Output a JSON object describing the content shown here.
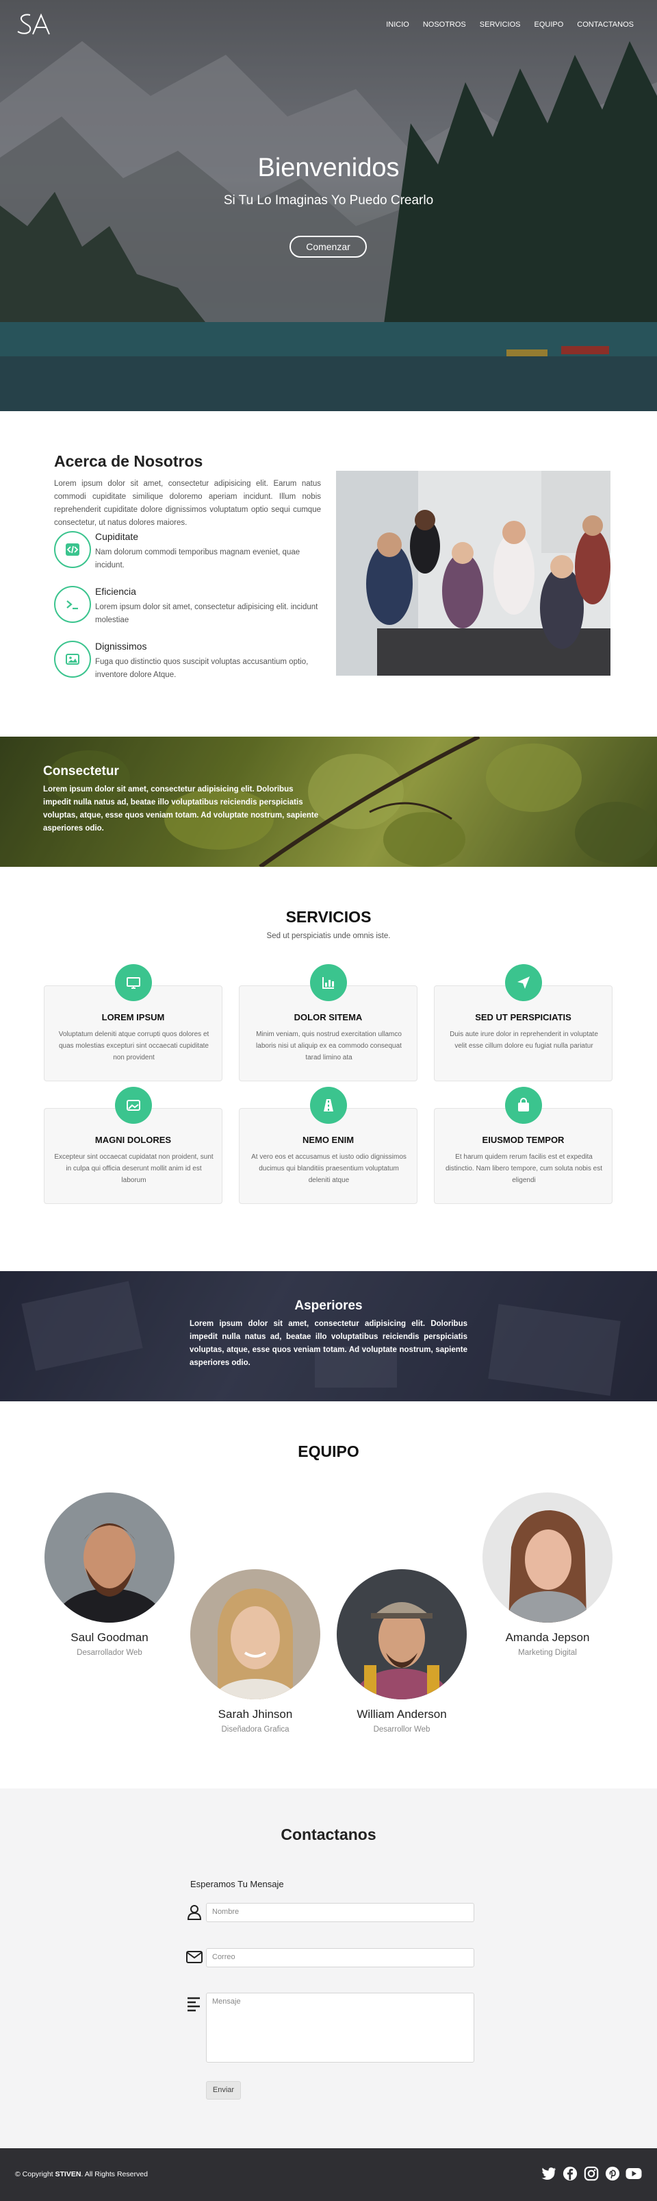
{
  "nav": {
    "items": [
      "INICIO",
      "NOSOTROS",
      "SERVICIOS",
      "EQUIPO",
      "CONTACTANOS"
    ]
  },
  "hero": {
    "title": "Bienvenidos",
    "subtitle": "Si Tu Lo Imaginas Yo Puedo Crearlo",
    "button": "Comenzar"
  },
  "about": {
    "title": "Acerca de Nosotros",
    "text": "Lorem ipsum dolor sit amet, consectetur adipisicing elit. Earum natus commodi cupiditate similique doloremo aperiam incidunt. Illum nobis reprehenderit cupiditate dolore dignissimos voluptatum optio sequi cumque consectetur, ut natus dolores maiores.",
    "features": [
      {
        "icon": "code-icon",
        "title": "Cupiditate",
        "text": "Nam dolorum commodi temporibus magnam eveniet, quae incidunt."
      },
      {
        "icon": "terminal-icon",
        "title": "Eficiencia",
        "text": "Lorem ipsum dolor sit amet, consectetur adipisicing elit. incidunt molestiae"
      },
      {
        "icon": "image-icon",
        "title": "Dignissimos",
        "text": "Fuga quo distinctio quos suscipit voluptas accusantium optio, inventore dolore Atque."
      }
    ]
  },
  "band1": {
    "title": "Consectetur",
    "text": "Lorem ipsum dolor sit amet, consectetur adipisicing elit. Doloribus impedit nulla natus ad, beatae illo voluptatibus reiciendis perspiciatis voluptas, atque, esse quos veniam totam. Ad voluptate nostrum, sapiente asperiores odio."
  },
  "services": {
    "title": "SERVICIOS",
    "subtitle": "Sed ut perspiciatis unde omnis iste.",
    "cards": [
      {
        "icon": "monitor-icon",
        "title": "LOREM IPSUM",
        "text": "Voluptatum deleniti atque corrupti quos dolores et quas molestias excepturi sint occaecati cupiditate non provident"
      },
      {
        "icon": "chart-icon",
        "title": "DOLOR SITEMA",
        "text": "Minim veniam, quis nostrud exercitation ullamco laboris nisi ut aliquip ex ea commodo consequat tarad limino ata"
      },
      {
        "icon": "send-icon",
        "title": "SED UT PERSPICIATIS",
        "text": "Duis aute irure dolor in reprehenderit in voluptate velit esse cillum dolore eu fugiat nulla pariatur"
      },
      {
        "icon": "image-icon",
        "title": "MAGNI DOLORES",
        "text": "Excepteur sint occaecat cupidatat non proident, sunt in culpa qui officia deserunt mollit anim id est laborum"
      },
      {
        "icon": "road-icon",
        "title": "NEMO ENIM",
        "text": "At vero eos et accusamus et iusto odio dignissimos ducimus qui blanditiis praesentium voluptatum deleniti atque"
      },
      {
        "icon": "bag-icon",
        "title": "EIUSMOD TEMPOR",
        "text": "Et harum quidem rerum facilis est et expedita distinctio. Nam libero tempore, cum soluta nobis est eligendi"
      }
    ]
  },
  "band2": {
    "title": "Asperiores",
    "text": "Lorem ipsum dolor sit amet, consectetur adipisicing elit. Doloribus impedit nulla natus ad, beatae illo voluptatibus reiciendis perspiciatis voluptas, atque, esse quos veniam totam. Ad voluptate nostrum, sapiente asperiores odio."
  },
  "team": {
    "title": "EQUIPO",
    "members": [
      {
        "name": "Saul Goodman",
        "role": "Desarrollador Web"
      },
      {
        "name": "Sarah Jhinson",
        "role": "Diseñadora Grafica"
      },
      {
        "name": "William Anderson",
        "role": "Desarrollor Web"
      },
      {
        "name": "Amanda Jepson",
        "role": "Marketing Digital"
      }
    ]
  },
  "contact": {
    "title": "Contactanos",
    "subtitle": "Esperamos Tu Mensaje",
    "name_placeholder": "Nombre",
    "email_placeholder": "Correo",
    "message_placeholder": "Mensaje",
    "send": "Enviar"
  },
  "footer": {
    "prefix": "© Copyright",
    "brand": "STIVEN",
    "suffix": ". All Rights Reserved"
  },
  "colors": {
    "accent": "#3bc48e",
    "footer": "#2f2f33"
  }
}
